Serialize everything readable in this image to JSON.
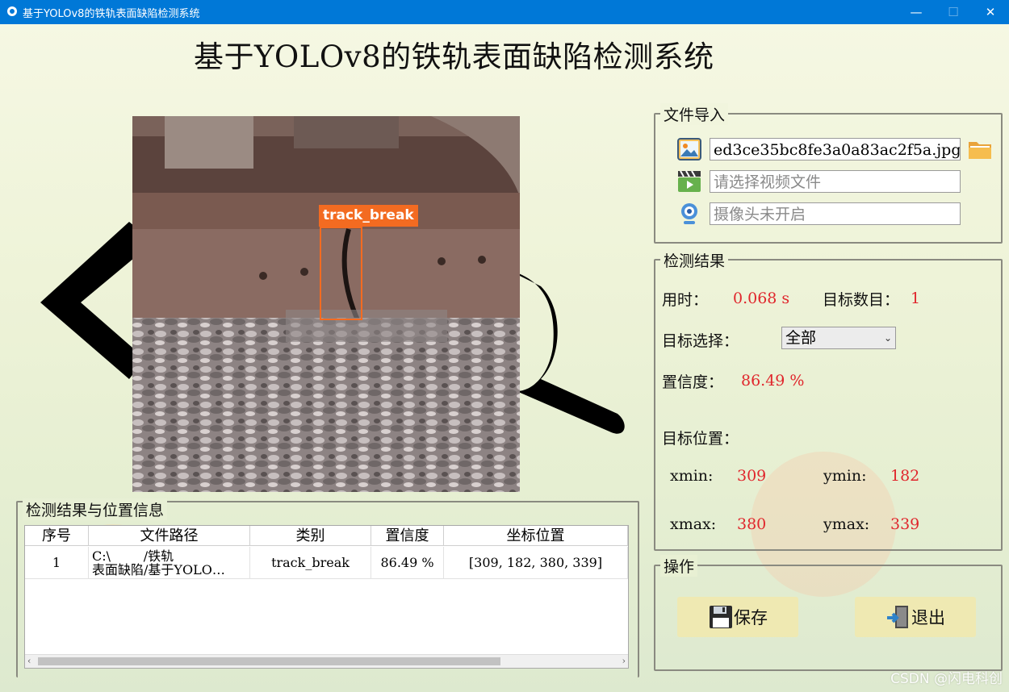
{
  "window": {
    "title": "基于YOLOv8的铁轨表面缺陷检测系统",
    "minimize_icon": "minimize-icon",
    "maximize_icon": "maximize-icon",
    "close_icon": "close-icon"
  },
  "heading": "基于YOLOv8的铁轨表面缺陷检测系统",
  "image_view": {
    "detection_label": "track_break",
    "box_color": "#f36b21"
  },
  "file_import": {
    "title": "文件导入",
    "image_path": "ed3ce35bc8fe3a0a83ac2f5a.jpg",
    "video_placeholder": "请选择视频文件",
    "camera_status": "摄像头未开启",
    "image_icon": "image-icon",
    "video_icon": "video-icon",
    "camera_icon": "webcam-icon",
    "folder_icon": "folder-icon"
  },
  "results": {
    "title": "检测结果",
    "time_label": "用时：",
    "time_value": "0.068 s",
    "count_label": "目标数目：",
    "count_value": "1",
    "select_label": "目标选择：",
    "select_value": "全部",
    "conf_label": "置信度：",
    "conf_value": "86.49 %",
    "pos_label": "目标位置：",
    "xmin_label": "xmin:",
    "xmin_value": "309",
    "ymin_label": "ymin:",
    "ymin_value": "182",
    "xmax_label": "xmax:",
    "xmax_value": "380",
    "ymax_label": "ymax:",
    "ymax_value": "339"
  },
  "operations": {
    "title": "操作",
    "save_label": "保存",
    "exit_label": "退出",
    "save_icon": "floppy-disk-icon",
    "exit_icon": "exit-door-icon"
  },
  "table": {
    "title": "检测结果与位置信息",
    "headers": [
      "序号",
      "文件路径",
      "类别",
      "置信度",
      "坐标位置"
    ],
    "rows": [
      [
        "1",
        "C:…/铁轨表面缺陷/基于YOLO…",
        "track_break",
        "86.49 %",
        "[309, 182, 380, 339]"
      ]
    ],
    "path_line1": "C:\\        /铁轨",
    "path_line2": "表面缺陷/基于YOLO…"
  },
  "colors": {
    "titlebar": "#0078d7",
    "value_red": "#e0262c",
    "button_bg": "#efe9b2"
  },
  "watermark": "CSDN @闪电科创"
}
